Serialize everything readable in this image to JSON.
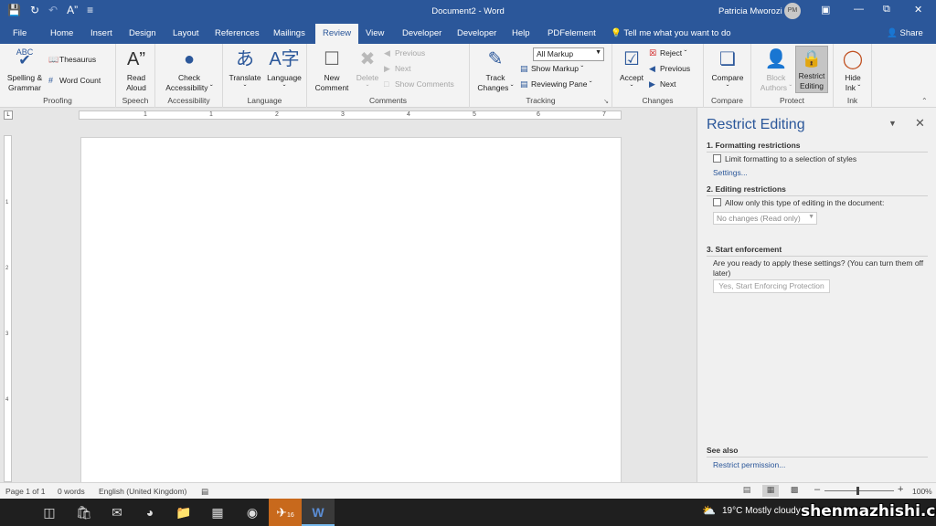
{
  "titlebar": {
    "document_title": "Document2 - Word",
    "user_name": "Patricia Mworozi",
    "avatar_initials": "PM"
  },
  "tabs": [
    "File",
    "Home",
    "Insert",
    "Design",
    "Layout",
    "References",
    "Mailings",
    "Review",
    "View",
    "Developer",
    "Developer",
    "Help",
    "PDFelement"
  ],
  "active_tab": "Review",
  "tell_me": "Tell me what you want to do",
  "share": "Share",
  "ribbon": {
    "proofing": {
      "label": "Proofing",
      "spelling": "Spelling &",
      "spelling2": "Grammar",
      "spelling_icon_text": "ABC",
      "thesaurus": "Thesaurus",
      "word_count": "Word Count",
      "word_count_icon_text": "ABC\n123"
    },
    "speech": {
      "label": "Speech",
      "read": "Read",
      "aloud": "Aloud"
    },
    "accessibility": {
      "label": "Accessibility",
      "check": "Check",
      "access": "Accessibility"
    },
    "language": {
      "label": "Language",
      "translate": "Translate",
      "language": "Language"
    },
    "comments": {
      "label": "Comments",
      "new": "New",
      "comment": "Comment",
      "delete": "Delete",
      "previous": "Previous",
      "next": "Next",
      "show_comments": "Show Comments"
    },
    "tracking": {
      "label": "Tracking",
      "track": "Track",
      "changes": "Changes",
      "markup_select": "All Markup",
      "show_markup": "Show Markup",
      "reviewing_pane": "Reviewing Pane"
    },
    "changes": {
      "label": "Changes",
      "accept": "Accept",
      "reject": "Reject",
      "previous": "Previous",
      "next": "Next"
    },
    "compare": {
      "label": "Compare",
      "compare": "Compare"
    },
    "protect": {
      "label": "Protect",
      "block": "Block",
      "authors": "Authors",
      "restrict": "Restrict",
      "editing": "Editing"
    },
    "ink": {
      "label": "Ink",
      "hide": "Hide",
      "ink": "Ink"
    }
  },
  "ruler": {
    "h_numbers": [
      "1",
      "1",
      "2",
      "3",
      "4",
      "5",
      "6",
      "7"
    ],
    "v_numbers": [
      "1",
      "2",
      "3",
      "4"
    ]
  },
  "pane": {
    "title": "Restrict Editing",
    "section1": "1. Formatting restrictions",
    "formatting_checkbox": "Limit formatting to a selection of styles",
    "settings_link": "Settings...",
    "section2": "2. Editing restrictions",
    "editing_checkbox": "Allow only this type of editing in the document:",
    "editing_select": "No changes (Read only)",
    "section3": "3. Start enforcement",
    "enforce_text": "Are you ready to apply these settings? (You can turn them off later)",
    "enforce_button": "Yes, Start Enforcing Protection",
    "see_also": "See also",
    "restrict_permission": "Restrict permission..."
  },
  "status": {
    "page": "Page 1 of 1",
    "words": "0 words",
    "language": "English (United Kingdom)",
    "zoom": "100%"
  },
  "taskbar": {
    "weather": "19°C  Mostly cloudy",
    "watermark": "shenmazhishi.com",
    "clock_badge": "16"
  }
}
